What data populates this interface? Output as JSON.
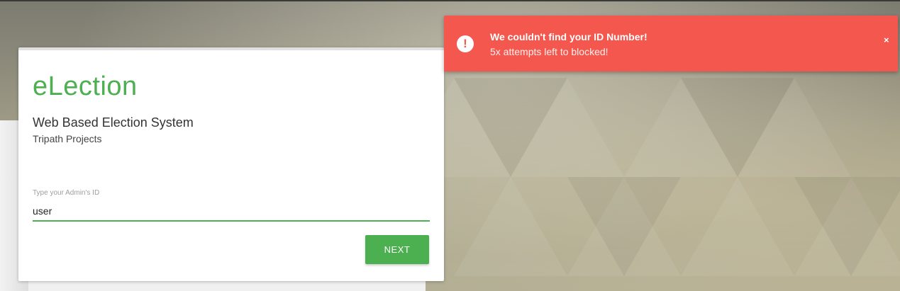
{
  "brand": {
    "title": "eLection",
    "subtitle": "Web Based Election System",
    "caption": "Tripath Projects"
  },
  "login": {
    "id_label": "Type your Admin's ID",
    "id_value": "user",
    "next_label": "NEXT"
  },
  "alert": {
    "icon": "exclamation-circle-icon",
    "icon_glyph": "!",
    "title": "We couldn't find your ID Number!",
    "message": "5x attempts left to blocked!",
    "close_glyph": "×"
  },
  "colors": {
    "accent": "#4caf50",
    "alert": "#f3574e",
    "card": "#ffffff"
  }
}
